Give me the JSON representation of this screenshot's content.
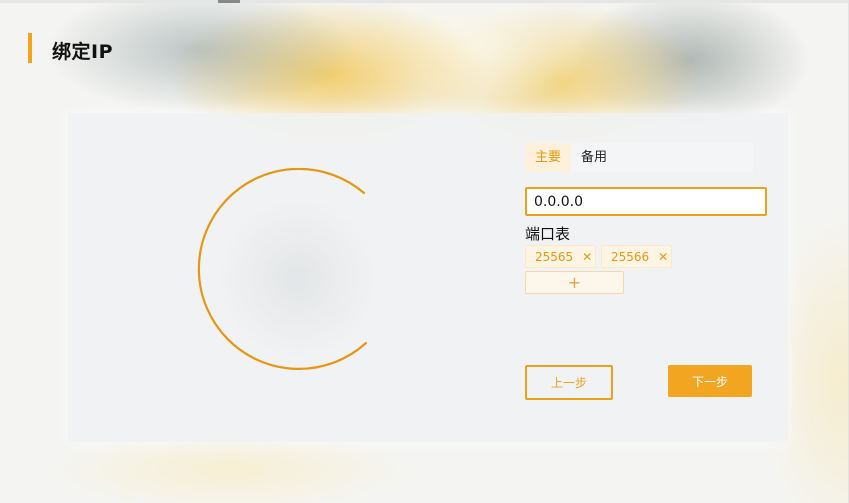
{
  "page": {
    "title": "绑定IP"
  },
  "address_tabs": [
    {
      "label": "主要",
      "active": true
    },
    {
      "label": "备用",
      "active": false
    }
  ],
  "ip_field": {
    "value": "0.0.0.0"
  },
  "ports": {
    "label": "端口表",
    "tags": [
      "25565",
      "25566"
    ],
    "add_icon": "plus-icon",
    "remove_icon": "close-icon"
  },
  "actions": {
    "prev_label": "上一步",
    "next_label": "下一步"
  },
  "colors": {
    "accent": "#f2a521",
    "accent_dark": "#e9990e",
    "tag_bg": "#fdf4e3",
    "tab_active_bg": "#fdf1dc",
    "card_bg": "#f1f2f3"
  }
}
